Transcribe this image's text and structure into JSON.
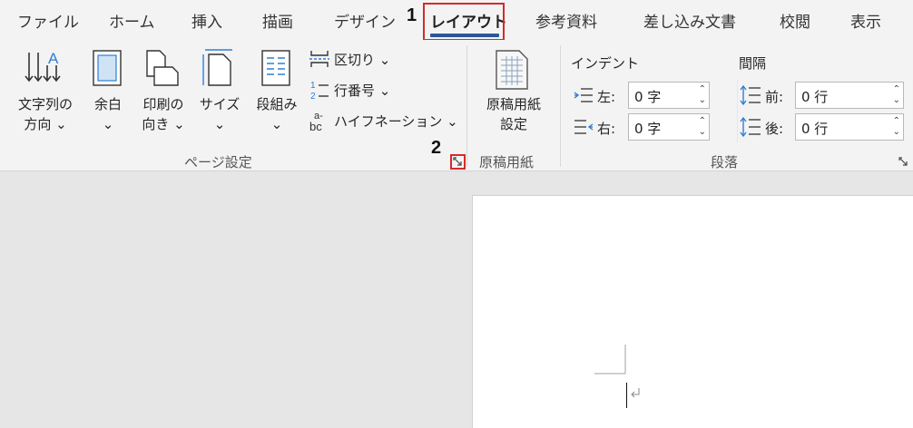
{
  "tabs": [
    "ファイル",
    "ホーム",
    "挿入",
    "描画",
    "デザイン",
    "レイアウト",
    "参考資料",
    "差し込み文書",
    "校閲",
    "表示"
  ],
  "annotations": {
    "step1": "1",
    "step2": "2"
  },
  "page_setup": {
    "text_direction": {
      "line1": "文字列の",
      "line2": "方向 ⌄"
    },
    "margins": {
      "line1": "余白",
      "line2": "⌄"
    },
    "orientation": {
      "line1": "印刷の",
      "line2": "向き ⌄"
    },
    "size": {
      "line1": "サイズ",
      "line2": "⌄"
    },
    "columns": {
      "line1": "段組み",
      "line2": "⌄"
    },
    "breaks": "区切り ⌄",
    "line_numbers": "行番号 ⌄",
    "hyphenation": "ハイフネーション ⌄",
    "group_label": "ページ設定"
  },
  "genko": {
    "button": {
      "line1": "原稿用紙",
      "line2": "設定"
    },
    "group_label": "原稿用紙"
  },
  "paragraph": {
    "indent_title": "インデント",
    "spacing_title": "間隔",
    "left_label": "左:",
    "right_label": "右:",
    "before_label": "前:",
    "after_label": "後:",
    "left_value": "0 字",
    "right_value": "0 字",
    "before_value": "0 行",
    "after_value": "0 行",
    "group_label": "段落"
  },
  "colors": {
    "accent": "#2b579a",
    "annotation_red": "#d42a2a",
    "icon_blue": "#2f7fd3"
  }
}
